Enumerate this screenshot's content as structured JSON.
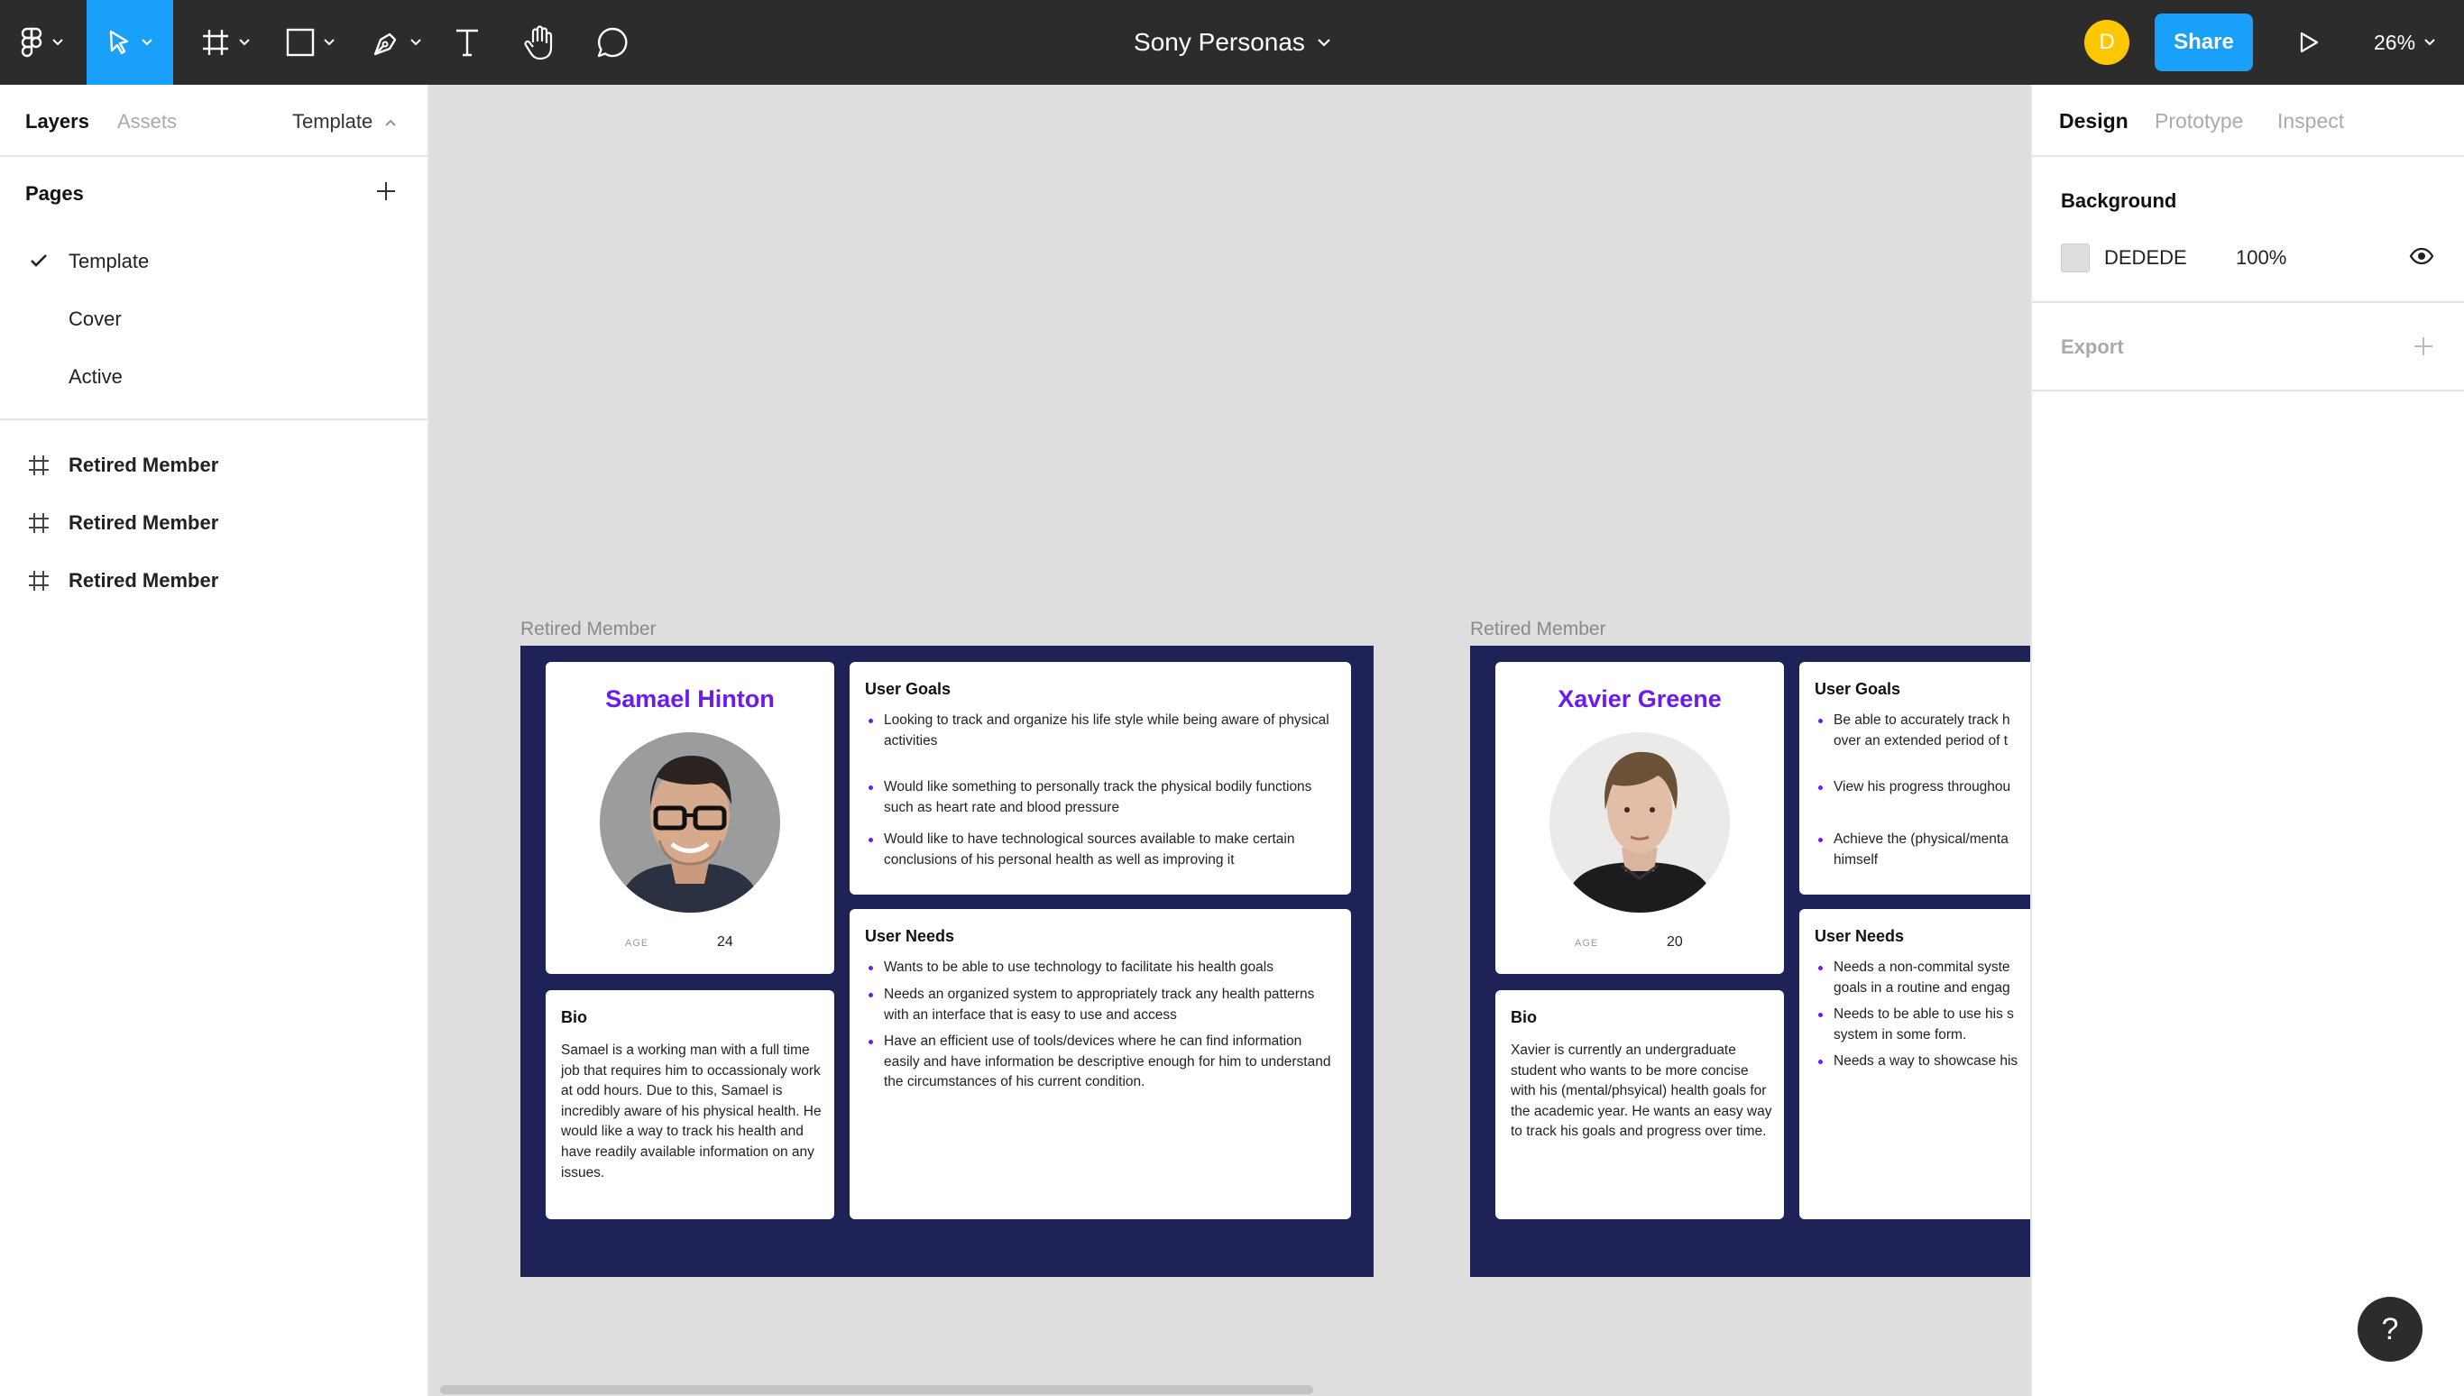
{
  "app": {
    "file_title": "Sony Personas",
    "user_initial": "D",
    "share_label": "Share",
    "zoom": "26%",
    "help_label": "?"
  },
  "left_panel": {
    "tabs": [
      "Layers",
      "Assets"
    ],
    "page_selector": "Template",
    "pages_heading": "Pages",
    "pages": [
      {
        "label": "Template",
        "selected": true
      },
      {
        "label": "Cover",
        "selected": false
      },
      {
        "label": "Active",
        "selected": false
      }
    ],
    "layers": [
      "Retired Member",
      "Retired Member",
      "Retired Member"
    ]
  },
  "right_panel": {
    "tabs": [
      "Design",
      "Prototype",
      "Inspect"
    ],
    "background_heading": "Background",
    "background_hex": "DEDEDE",
    "background_opacity": "100%",
    "export_heading": "Export"
  },
  "colors": {
    "toolbar": "#2c2c2c",
    "accent": "#18a0fb",
    "frame": "#1e2257",
    "name_purple": "#6a1bf0",
    "canvas": "#dedede"
  },
  "canvas": {
    "frames": [
      {
        "label": "Retired Member",
        "persona_name": "Samael Hinton",
        "age_label": "AGE",
        "age": "24",
        "bio_heading": "Bio",
        "bio": "Samael is a working man with a full time job that requires him to occassionaly work at odd hours. Due to this, Samael is incredibly aware of his physical health. He would like a way to track his health and have readily available information on any issues.",
        "goals_heading": "User Goals",
        "goals": [
          "Looking to track and organize his life style while being aware of physical activities",
          "Would like something to personally track the physical bodily functions such as heart rate and blood pressure",
          "Would like to have technological sources available to make certain conclusions of his personal health as well as improving it"
        ],
        "needs_heading": "User Needs",
        "needs": [
          "Wants to be able to use technology to facilitate his health goals",
          "Needs an organized system to appropriately track any health patterns with an interface that is easy to use and access",
          "Have an efficient use of tools/devices where he can find information easily and have information be descriptive enough for him to understand the circumstances of his current condition."
        ]
      },
      {
        "label": "Retired Member",
        "persona_name": "Xavier Greene",
        "age_label": "AGE",
        "age": "20",
        "bio_heading": "Bio",
        "bio": "Xavier is currently an undergraduate student who wants to be more concise with his (mental/phsyical) health goals for the academic year. He wants an easy way to track his goals and progress over time.",
        "goals_heading": "User Goals",
        "goals": [
          "Be able to accurately track h over an extended period of t",
          "View his progress throughou",
          "Achieve the (physical/menta himself"
        ],
        "needs_heading": "User Needs",
        "needs": [
          "Needs a non-commital syste goals in a routine and engag",
          "Needs to be able to use his s system in some form.",
          "Needs a way to showcase his"
        ]
      }
    ]
  }
}
